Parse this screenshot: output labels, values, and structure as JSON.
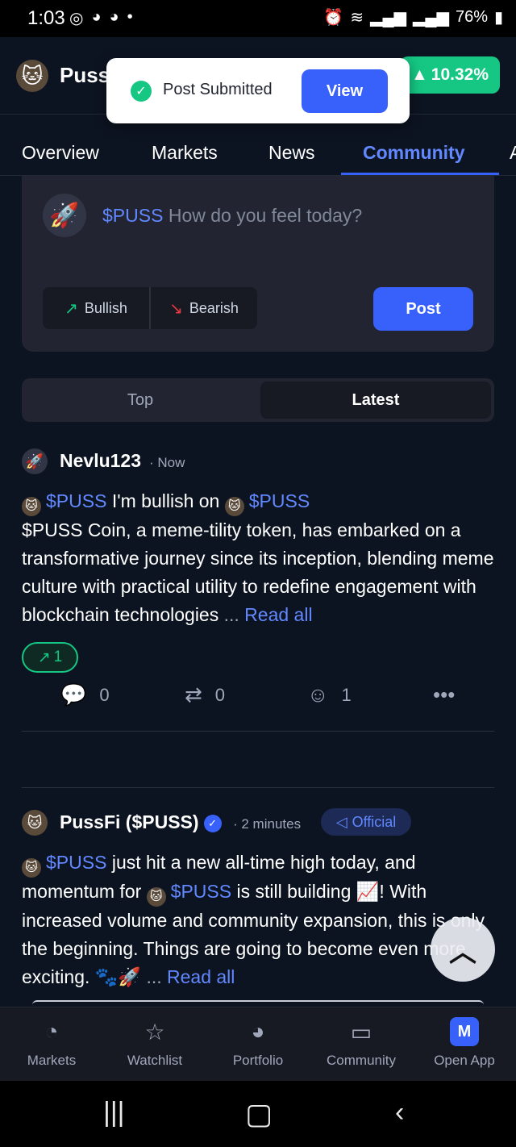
{
  "status_bar": {
    "time": "1:03",
    "left_icons": [
      "whatsapp-icon",
      "discord-icon",
      "discord-icon",
      "dot"
    ],
    "battery": "76%"
  },
  "header": {
    "coin_name": "Puss",
    "change": "10.32%",
    "change_color": "#16c784"
  },
  "toast": {
    "message": "Post Submitted",
    "view_label": "View"
  },
  "tabs": [
    {
      "label": "Overview"
    },
    {
      "label": "Markets"
    },
    {
      "label": "News"
    },
    {
      "label": "Community",
      "active": true
    },
    {
      "label": "A"
    }
  ],
  "composer": {
    "tag": "$PUSS",
    "prompt": "How do you feel today?",
    "bullish_label": "Bullish",
    "bearish_label": "Bearish",
    "post_label": "Post"
  },
  "feed_toggle": {
    "top": "Top",
    "latest": "Latest",
    "selected": "Latest"
  },
  "posts": [
    {
      "author": "Nevlu123",
      "time": "· Now",
      "tag1": "$PUSS",
      "text1": "I'm bullish on",
      "tag2": "$PUSS",
      "body": "$PUSS Coin, a meme-tility token, has embarked on a transformative journey since its inception, blending meme culture with practical utility to redefine engagement with blockchain technologies",
      "ellipsis": "...",
      "read_all": "Read all",
      "bullish_count": "1",
      "comments": "0",
      "reposts": "0",
      "reactions": "1"
    },
    {
      "author": "PussFi ($PUSS)",
      "time": "· 2 minutes",
      "badge": "Official",
      "tag1": "$PUSS",
      "text1": "just hit a new all-time high today, and momentum for",
      "tag2": "$PUSS",
      "text2": "is still building",
      "text3": "! With increased volume and community expansion, this is only the beginning. Things are going to become even more exciting.",
      "ellipsis": "...",
      "read_all": "Read all"
    }
  ],
  "bottom_nav": [
    {
      "label": "Markets",
      "icon": "markets-icon"
    },
    {
      "label": "Watchlist",
      "icon": "star-icon"
    },
    {
      "label": "Portfolio",
      "icon": "pie-chart-icon"
    },
    {
      "label": "Community",
      "icon": "chat-icon"
    },
    {
      "label": "Open App",
      "icon": "cmc-app-icon"
    }
  ],
  "colors": {
    "background": "#0d1421",
    "accent": "#3861fb",
    "link": "#6188ff",
    "bullish": "#16c784",
    "bearish": "#ea3943"
  }
}
